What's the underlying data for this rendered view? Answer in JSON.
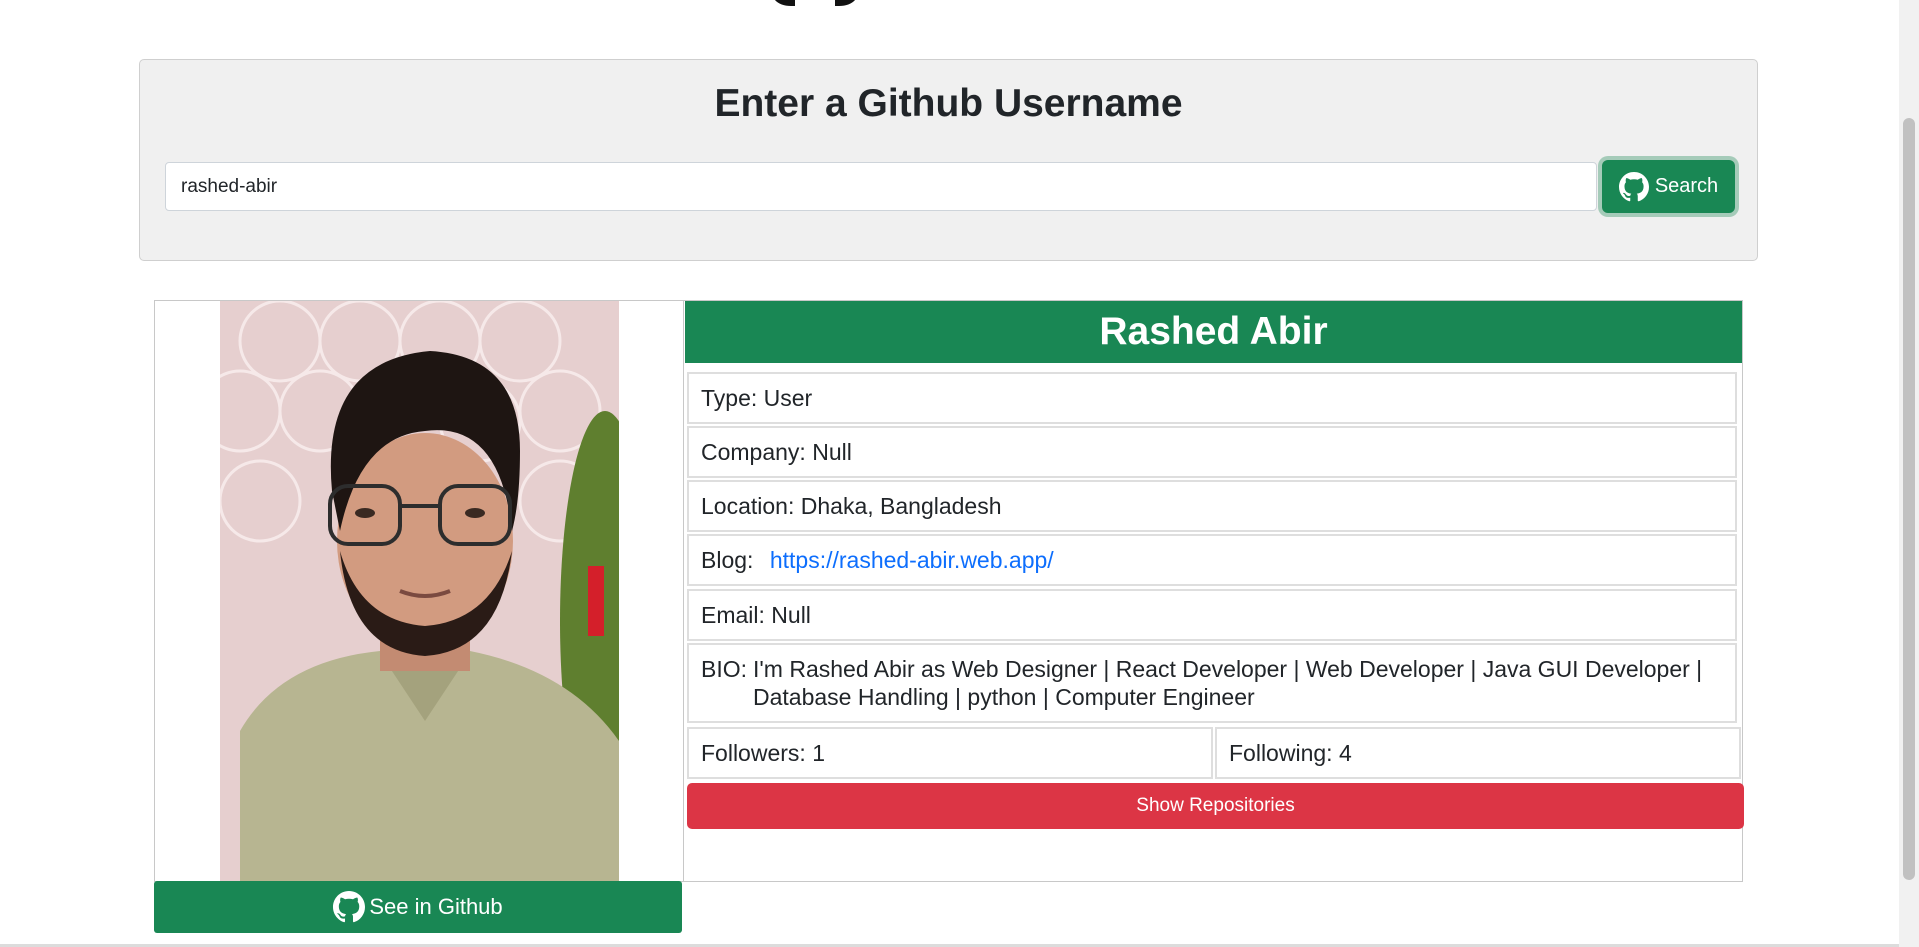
{
  "search": {
    "title": "Enter a Github Username",
    "input_value": "rashed-abir",
    "button_label": "Search"
  },
  "profile": {
    "name": "Rashed Abir",
    "type_label": "Type:",
    "type_value": "User",
    "company_label": "Company:",
    "company_value": "Null",
    "location_label": "Location:",
    "location_value": "Dhaka, Bangladesh",
    "blog_label": "Blog:",
    "blog_value": "https://rashed-abir.web.app/",
    "email_label": "Email:",
    "email_value": "Null",
    "bio_label": "BIO:",
    "bio_value": "I'm Rashed Abir as Web Designer | React Developer | Web Developer | Java GUI Developer | Database Handling | python | Computer Engineer",
    "followers_label": "Followers:",
    "followers_value": "1",
    "following_label": "Following:",
    "following_value": "4",
    "show_repos_label": "Show Repositories",
    "see_github_label": "See in Github"
  },
  "colors": {
    "primary_green": "#198754",
    "danger_red": "#dc3545",
    "link_blue": "#0d6efd"
  },
  "icons": {
    "search_button": "github-icon",
    "see_github_button": "github-icon"
  }
}
